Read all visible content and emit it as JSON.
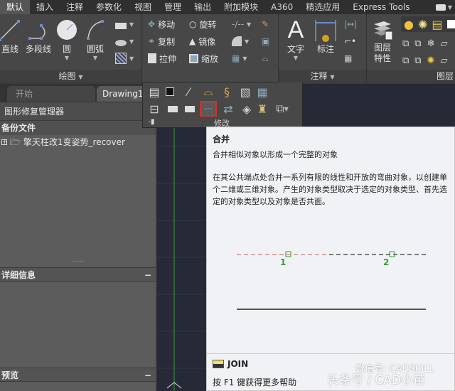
{
  "menu_tabs": [
    {
      "label": "默认",
      "active": true
    },
    {
      "label": "插入"
    },
    {
      "label": "注释"
    },
    {
      "label": "参数化"
    },
    {
      "label": "视图"
    },
    {
      "label": "管理"
    },
    {
      "label": "输出"
    },
    {
      "label": "附加模块"
    },
    {
      "label": "A360"
    },
    {
      "label": "精选应用"
    },
    {
      "label": "Express Tools"
    }
  ],
  "ribbon": {
    "draw": {
      "title": "绘图",
      "buttons": [
        {
          "label": "直线",
          "icon": "line-icon"
        },
        {
          "label": "多段线",
          "icon": "polyline-icon"
        },
        {
          "label": "圆",
          "icon": "circle-icon"
        },
        {
          "label": "圆弧",
          "icon": "arc-icon"
        }
      ]
    },
    "modify": {
      "title": "修改",
      "buttons": [
        {
          "label": "移动",
          "icon": "move-icon"
        },
        {
          "label": "旋转",
          "icon": "rotate-icon"
        },
        {
          "label": "复制",
          "icon": "copy-icon"
        },
        {
          "label": "镜像",
          "icon": "mirror-icon"
        },
        {
          "label": "拉伸",
          "icon": "stretch-icon"
        },
        {
          "label": "缩放",
          "icon": "scale-icon"
        }
      ]
    },
    "annotation": {
      "title": "注释",
      "buttons": [
        {
          "label": "文字",
          "icon": "text-icon"
        },
        {
          "label": "标注",
          "icon": "dimension-icon"
        }
      ]
    },
    "layers": {
      "title": "图层",
      "buttons": [
        {
          "label": "图层特性",
          "icon": "layer-properties-icon"
        }
      ]
    }
  },
  "file_tabs": [
    {
      "label": "开始"
    },
    {
      "label": "Drawing1",
      "active": true
    }
  ],
  "left_panel": {
    "title": "图形修复管理器",
    "backup_section": "备份文件",
    "backup_items": [
      {
        "label": "擎天柱改1变姿势_recover"
      }
    ],
    "details_section": "详细信息",
    "preview_section": "预览",
    "collapse_symbol": "−"
  },
  "flyout": {
    "title": "修改",
    "highlighted_tool": "join-icon"
  },
  "tooltip": {
    "title": "合并",
    "subtitle": "合并相似对象以形成一个完整的对象",
    "description": "在其公共端点处合并一系列有限的线性和开放的弯曲对象，以创建单个二维或三维对象。产生的对象类型取决于选定的对象类型、首先选定的对象类型以及对象是否共面。",
    "illustration_labels": [
      "1",
      "2"
    ],
    "command": "JOIN",
    "help": "按 F1 键获得更多帮助"
  },
  "watermark": {
    "line1": "微信号: CADSKILL",
    "line2": "头条号 / CAD小苗"
  },
  "colors": {
    "highlight_border": "#d0312d",
    "illustration_red": "#d08070",
    "illustration_green": "#3a9a3a",
    "canvas_bg": "#252a36"
  }
}
